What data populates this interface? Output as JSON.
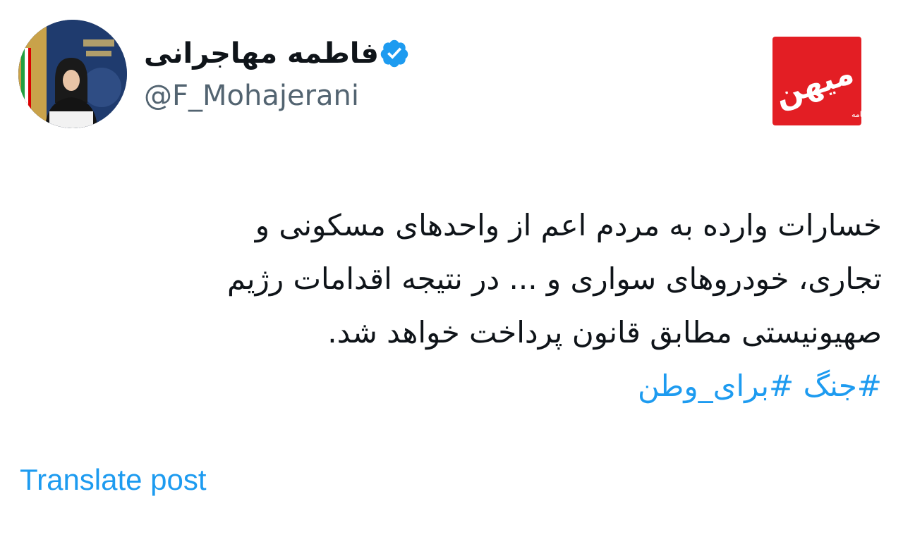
{
  "author": {
    "display_name": "فاطمه مهاجرانی",
    "handle": "@F_Mohajerani",
    "verified": true,
    "avatar_icon": "profile-photo"
  },
  "publisher_logo": {
    "icon": "mehan-newspaper-logo",
    "brand_text": "میهن",
    "sub_text": "روزنامه",
    "color": "#e31e24"
  },
  "post": {
    "lines": [
      "خسارات وارده به مردم اعم از واحدهای مسکونی و",
      "تجاری، خودروهای سواری و ... در نتیجه اقدامات رژیم",
      "صهیونیستی مطابق قانون پرداخت خواهد شد."
    ],
    "hashtags": [
      "#جنگ",
      "#برای_وطن"
    ]
  },
  "actions": {
    "translate_label": "Translate post"
  },
  "colors": {
    "link": "#1d9bf0",
    "text": "#0f1419",
    "muted": "#536471",
    "verified": "#1d9bf0"
  }
}
